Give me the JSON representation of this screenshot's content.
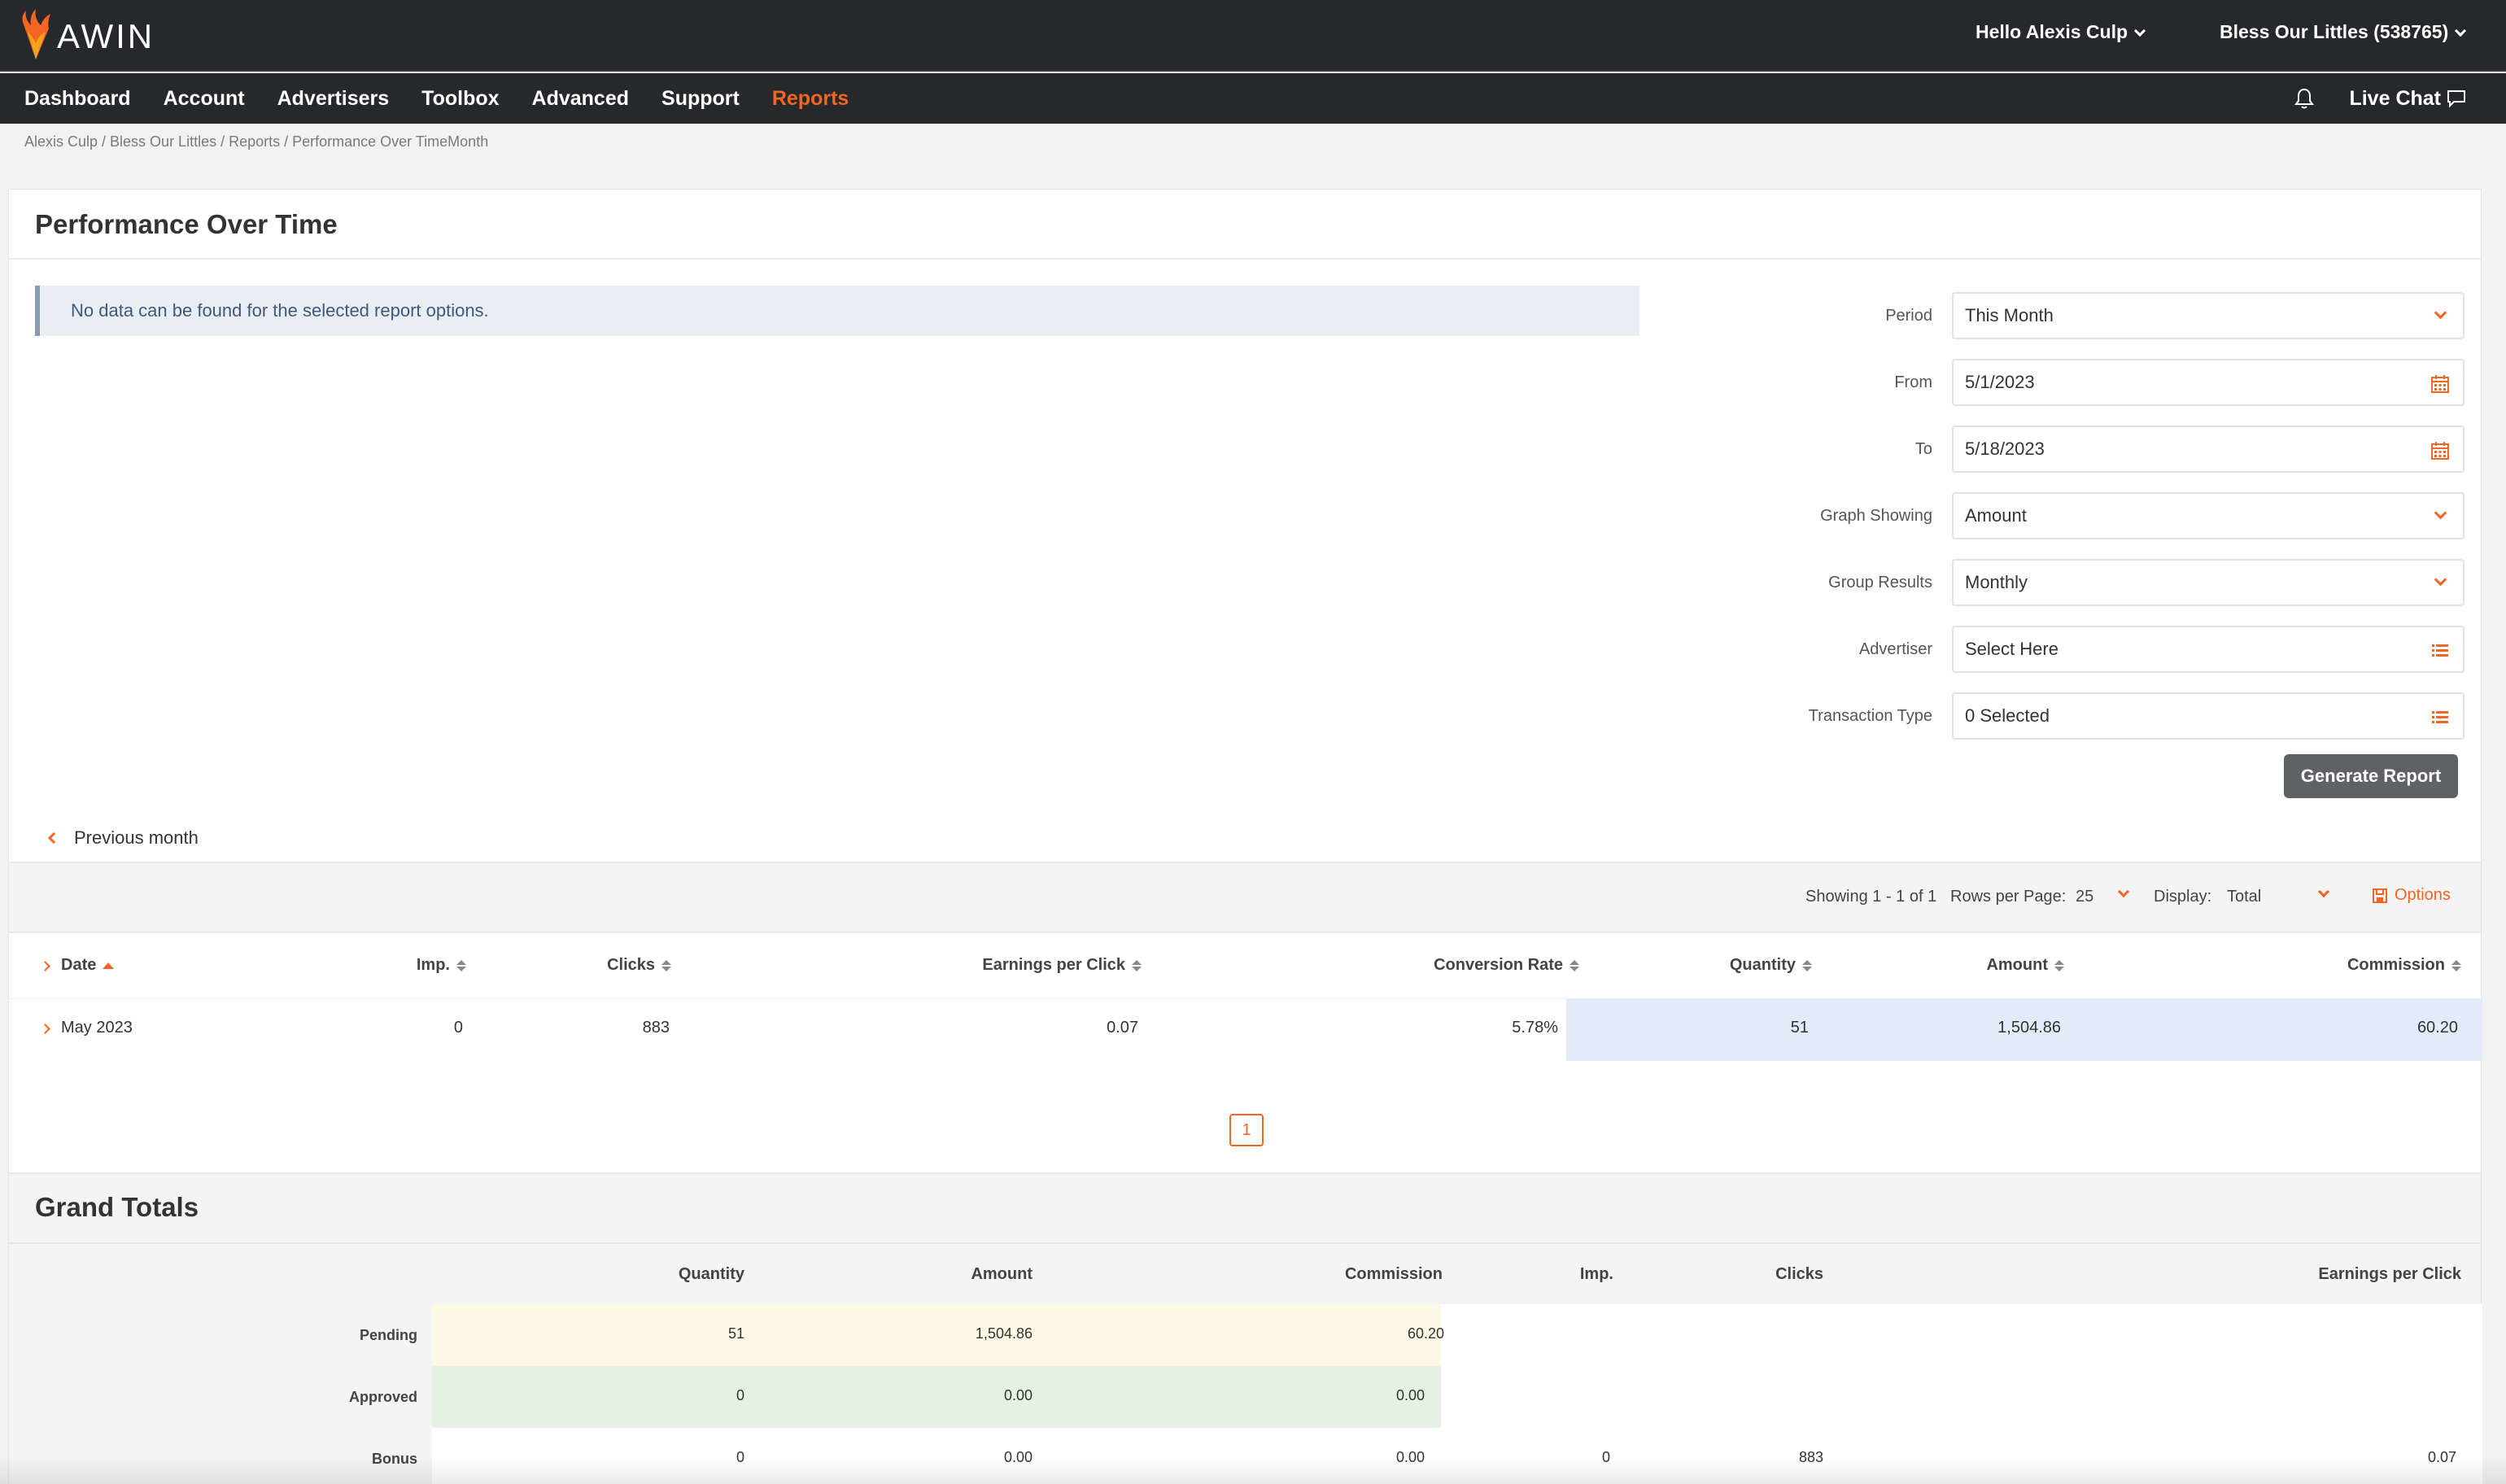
{
  "brand": {
    "name": "AWIN",
    "accent": "#f26522",
    "bar": "#26282c"
  },
  "top": {
    "greeting": "Hello Alexis Culp",
    "account": "Bless Our Littles (538765)"
  },
  "nav": {
    "items": [
      "Dashboard",
      "Account",
      "Advertisers",
      "Toolbox",
      "Advanced",
      "Support",
      "Reports"
    ],
    "active": "Reports",
    "live_chat": "Live Chat"
  },
  "breadcrumb": "Alexis Culp / Bless Our Littles / Reports / Performance Over TimeMonth",
  "page": {
    "title": "Performance Over Time",
    "alert": "No data can be found for the selected report options."
  },
  "form": {
    "period": {
      "label": "Period",
      "value": "This Month"
    },
    "from": {
      "label": "From",
      "value": "5/1/2023"
    },
    "to": {
      "label": "To",
      "value": "5/18/2023"
    },
    "graph_showing": {
      "label": "Graph Showing",
      "value": "Amount"
    },
    "group_results": {
      "label": "Group Results",
      "value": "Monthly"
    },
    "advertiser": {
      "label": "Advertiser",
      "value": "Select Here"
    },
    "transaction_type": {
      "label": "Transaction Type",
      "value": "0 Selected"
    },
    "generate_label": "Generate Report"
  },
  "prev_month": "Previous month",
  "toolbar": {
    "showing": "Showing 1 - 1 of 1",
    "rows_per_page_label": "Rows per Page:",
    "rows_per_page": "25",
    "display_label": "Display:",
    "display_value": "Total",
    "options": "Options"
  },
  "table": {
    "headers": {
      "date": "Date",
      "imp": "Imp.",
      "clicks": "Clicks",
      "epc": "Earnings per Click",
      "conversion": "Conversion Rate",
      "quantity": "Quantity",
      "amount": "Amount",
      "commission": "Commission"
    },
    "rows": [
      {
        "date": "May 2023",
        "imp": "0",
        "clicks": "883",
        "epc": "0.07",
        "conversion": "5.78%",
        "quantity": "51",
        "amount": "1,504.86",
        "commission": "60.20"
      }
    ],
    "page": "1"
  },
  "grand_totals": {
    "title": "Grand Totals",
    "headers": {
      "quantity": "Quantity",
      "amount": "Amount",
      "commission": "Commission",
      "imp": "Imp.",
      "clicks": "Clicks",
      "epc": "Earnings per Click"
    },
    "rows": [
      {
        "label": "Pending",
        "quantity": "51",
        "amount": "1,504.86",
        "commission": "60.20",
        "imp": "",
        "clicks": "",
        "epc": "",
        "color": "#fdf8e3"
      },
      {
        "label": "Approved",
        "quantity": "0",
        "amount": "0.00",
        "commission": "0.00",
        "imp": "",
        "clicks": "",
        "epc": "",
        "color": "#e4f2e1"
      },
      {
        "label": "Bonus",
        "quantity": "0",
        "amount": "0.00",
        "commission": "0.00",
        "imp": "0",
        "clicks": "883",
        "epc": "0.07",
        "color": "#ffffff"
      }
    ]
  }
}
